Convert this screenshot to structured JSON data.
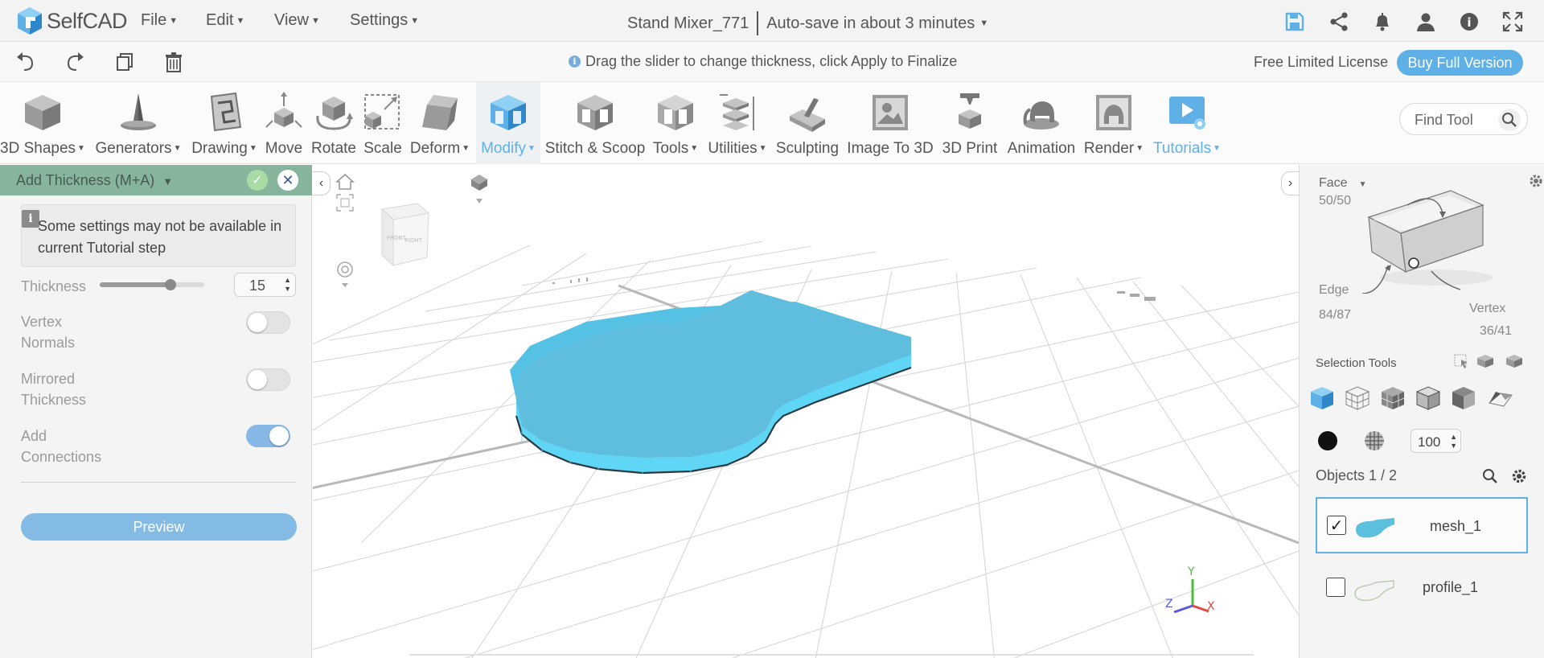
{
  "app": {
    "logo_text": "SelfCAD",
    "menus": [
      "File",
      "Edit",
      "View",
      "Settings"
    ],
    "project_name": "Stand Mixer_771",
    "autosave": "Auto-save in about 3 minutes"
  },
  "subbar": {
    "hint": "Drag the slider to change thickness, click Apply to Finalize",
    "license": "Free Limited License",
    "buy_label": "Buy Full Version"
  },
  "toolbar": {
    "tools": [
      {
        "label": "3D Shapes",
        "dropdown": true
      },
      {
        "label": "Generators",
        "dropdown": true
      },
      {
        "label": "Drawing",
        "dropdown": true
      },
      {
        "label": "Move",
        "dropdown": false
      },
      {
        "label": "Rotate",
        "dropdown": false
      },
      {
        "label": "Scale",
        "dropdown": false
      },
      {
        "label": "Deform",
        "dropdown": true
      },
      {
        "label": "Modify",
        "dropdown": true
      },
      {
        "label": "Stitch & Scoop",
        "dropdown": false
      },
      {
        "label": "Tools",
        "dropdown": true
      },
      {
        "label": "Utilities",
        "dropdown": true
      },
      {
        "label": "Sculpting",
        "dropdown": false
      },
      {
        "label": "Image To 3D",
        "dropdown": false
      },
      {
        "label": "3D Print",
        "dropdown": false
      },
      {
        "label": "Animation",
        "dropdown": false
      },
      {
        "label": "Render",
        "dropdown": true
      },
      {
        "label": "Tutorials",
        "dropdown": true
      }
    ],
    "find_placeholder": "Find Tool"
  },
  "panel": {
    "title": "Add Thickness (M+A)",
    "note": "Some settings may not be available in current Tutorial step",
    "thickness_label": "Thickness",
    "thickness_value": "15",
    "thickness_slider_fraction": 0.68,
    "vertex_normals_label_1": "Vertex",
    "vertex_normals_label_2": "Normals",
    "vertex_normals_on": false,
    "mirrored_label_1": "Mirrored",
    "mirrored_label_2": "Thickness",
    "mirrored_on": false,
    "connections_label_1": "Add",
    "connections_label_2": "Connections",
    "connections_on": true,
    "preview_label": "Preview"
  },
  "viewport": {
    "cube_front": "FRONT",
    "cube_right": "RIGHT",
    "axis_x": "X",
    "axis_y": "Y",
    "axis_z": "Z",
    "mesh_color": "#5bbfdd"
  },
  "right": {
    "face_label": "Face",
    "face_count": "50/50",
    "edge_label": "Edge",
    "edge_count": "84/87",
    "vertex_label": "Vertex",
    "vertex_count": "36/41",
    "selection_tools_label": "Selection Tools",
    "opacity_value": "100",
    "objects_label": "Objects 1 / 2",
    "objects": [
      {
        "name": "mesh_1",
        "checked": true
      },
      {
        "name": "profile_1",
        "checked": false
      }
    ]
  },
  "colors": {
    "accent": "#5fb0e6",
    "panel_header": "#86b59b"
  }
}
